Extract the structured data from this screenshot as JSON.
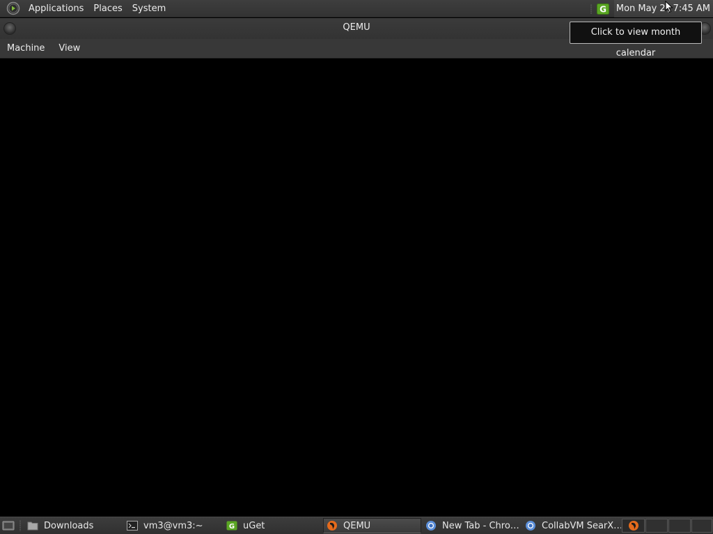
{
  "top_panel": {
    "menus": [
      "Applications",
      "Places",
      "System"
    ],
    "clock": "Mon May 2 , 7:45 AM"
  },
  "tooltip": {
    "text": "Click to view month calendar"
  },
  "window": {
    "title": "QEMU",
    "menubar": [
      "Machine",
      "View"
    ]
  },
  "taskbar": {
    "tasks": [
      {
        "label": "Downloads",
        "icon": "folder-icon",
        "active": false
      },
      {
        "label": "vm3@vm3:~",
        "icon": "terminal-icon",
        "active": false
      },
      {
        "label": "uGet",
        "icon": "uget-icon",
        "active": false
      },
      {
        "label": "QEMU",
        "icon": "qemu-icon",
        "active": true
      },
      {
        "label": "New Tab - Chro…",
        "icon": "chromium-icon",
        "active": false
      },
      {
        "label": "CollabVM SearX…",
        "icon": "chromium-icon",
        "active": false
      }
    ]
  },
  "colors": {
    "panel_bg": "#353535",
    "display_bg": "#000000",
    "uget_green": "#6cbf2c",
    "qemu_orange": "#e46a1c"
  }
}
